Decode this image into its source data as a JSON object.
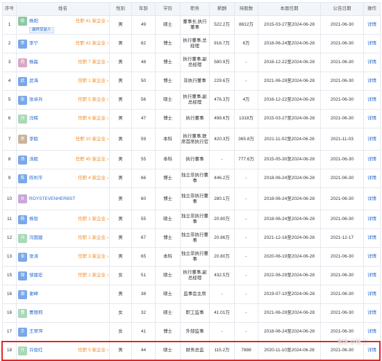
{
  "headers": [
    "序号",
    "姓名",
    "性别",
    "年龄",
    "学历",
    "职务",
    "薪酬",
    "持股数",
    "本届任期",
    "公告日期",
    "操作"
  ],
  "detail_label": "详情",
  "rows": [
    {
      "no": "1",
      "avatar": "杨",
      "avatar_color": "#8cc8a4",
      "name": "杨阳",
      "ent": "任职 41 家企业 ›",
      "tag": "最终受益人",
      "gender": "男",
      "age": "49",
      "edu": "硕士",
      "role": "董事长,执行董事",
      "pay": "522.2万",
      "shares": "8812万",
      "term": "2015-03-27至2024-06-28",
      "date": "2021-06-30"
    },
    {
      "no": "2",
      "avatar": "李",
      "avatar_color": "#7aa7e8",
      "name": "李宁",
      "ent": "任职 42 家企业 ›",
      "tag": "",
      "gender": "男",
      "age": "62",
      "edu": "博士",
      "role": "执行董事,总经理",
      "pay": "916.7万",
      "shares": "6万",
      "term": "2018-06-24至2024-06-28",
      "date": "2021-06-30"
    },
    {
      "no": "3",
      "avatar": "杨",
      "avatar_color": "#d8a8c4",
      "name": "杨磊",
      "ent": "任职 7 家企业 ›",
      "tag": "",
      "gender": "男",
      "age": "48",
      "edu": "博士",
      "role": "执行董事,副总经理",
      "pay": "580.9万",
      "shares": "-",
      "term": "2016-12-22至2024-06-28",
      "date": "2021-06-30"
    },
    {
      "no": "4",
      "avatar": "武",
      "avatar_color": "#7aa7e8",
      "name": "武海",
      "ent": "任职 1 家企业 ›",
      "tag": "",
      "gender": "男",
      "age": "50",
      "edu": "博士",
      "role": "非执行董事",
      "pay": "229.6万",
      "shares": "-",
      "term": "2021-06-29至2024-06-28",
      "date": "2021-06-30"
    },
    {
      "no": "5",
      "avatar": "张",
      "avatar_color": "#7aa7e8",
      "name": "张卓兵",
      "ent": "任职 5 家企业 ›",
      "tag": "",
      "gender": "男",
      "age": "56",
      "edu": "硕士",
      "role": "执行董事,副总经理",
      "pay": "476.3万",
      "shares": "4万",
      "term": "2016-12-22至2024-06-28",
      "date": "2021-06-30"
    },
    {
      "no": "6",
      "avatar": "冯",
      "avatar_color": "#a8d8b8",
      "name": "冯辉",
      "ent": "任职 6 家企业 ›",
      "tag": "",
      "gender": "男",
      "age": "47",
      "edu": "博士",
      "role": "执行董事",
      "pay": "498.6万",
      "shares": "1318万",
      "term": "2015-03-27至2024-06-28",
      "date": "2021-06-30"
    },
    {
      "no": "7",
      "avatar": "李",
      "avatar_color": "#c8b49c",
      "name": "李毅",
      "ent": "任职 10 家企业 ›",
      "tag": "",
      "gender": "男",
      "age": "59",
      "edu": "本科",
      "role": "执行董事,联席首席执行官",
      "pay": "420.3万",
      "shares": "365.8万",
      "term": "2021-11-02至2024-06-28",
      "date": "2021-11-03",
      "tall": true
    },
    {
      "no": "8",
      "avatar": "汤",
      "avatar_color": "#7aa7e8",
      "name": "汤毅",
      "ent": "任职 45 家企业 ›",
      "tag": "",
      "gender": "男",
      "age": "55",
      "edu": "本科",
      "role": "执行董事",
      "pay": "-",
      "shares": "777.6万",
      "term": "2015-05-30至2024-06-28",
      "date": "2021-06-30"
    },
    {
      "no": "9",
      "avatar": "陈",
      "avatar_color": "#7aa7e8",
      "name": "陈利平",
      "ent": "任职 4 家企业 ›",
      "tag": "",
      "gender": "男",
      "age": "66",
      "edu": "博士",
      "role": "独立非执行董事",
      "pay": "446.2万",
      "shares": "-",
      "term": "2018-06-24至2024-06-28",
      "date": "2021-06-30"
    },
    {
      "no": "10",
      "avatar": "R",
      "avatar_color": "#c8a8d8",
      "name": "ROYSTEVENHERBST",
      "ent": "",
      "tag": "",
      "gender": "男",
      "age": "60",
      "edu": "博士",
      "role": "独立非执行董事",
      "pay": "280.1万",
      "shares": "-",
      "term": "2018-06-24至2024-06-28",
      "date": "2021-06-30",
      "tall": true
    },
    {
      "no": "11",
      "avatar": "杨",
      "avatar_color": "#7aa7e8",
      "name": "杨智",
      "ent": "任职 1 家企业 ›",
      "tag": "",
      "gender": "男",
      "age": "55",
      "edu": "硕士",
      "role": "独立非执行董事",
      "pay": "20.80万",
      "shares": "-",
      "term": "2018-06-24至2024-06-28",
      "date": "2021-06-30"
    },
    {
      "no": "12",
      "avatar": "冯",
      "avatar_color": "#a8d8b8",
      "name": "冯国建",
      "ent": "任职 1 家企业 ›",
      "tag": "",
      "gender": "男",
      "age": "67",
      "edu": "博士",
      "role": "独立非执行董事",
      "pay": "20.86万",
      "shares": "-",
      "term": "2021-12-16至2024-06-28",
      "date": "2021-12-17"
    },
    {
      "no": "13",
      "avatar": "张",
      "avatar_color": "#7aa7e8",
      "name": "张涛",
      "ent": "任职 3 家企业 ›",
      "tag": "",
      "gender": "男",
      "age": "65",
      "edu": "本科",
      "role": "独立非执行董事",
      "pay": "20.80万",
      "shares": "-",
      "term": "2020-06-19至2024-06-28",
      "date": "2021-06-30"
    },
    {
      "no": "15",
      "avatar": "邹",
      "avatar_color": "#7aa7e8",
      "name": "邹建宏",
      "ent": "任职 1 家企业 ›",
      "tag": "",
      "gender": "女",
      "age": "51",
      "edu": "硕士",
      "role": "执行董事,副总经理",
      "pay": "432.5万",
      "shares": "-",
      "term": "2022-06-29至2024-06-28",
      "date": "2021-06-30"
    },
    {
      "no": "16",
      "avatar": "谢",
      "avatar_color": "#7aa7e8",
      "name": "谢峰",
      "ent": "",
      "tag": "",
      "gender": "男",
      "age": "38",
      "edu": "硕士",
      "role": "监事会主席",
      "pay": "-",
      "shares": "-",
      "term": "2019-07-10至2024-06-28",
      "date": "2021-06-30"
    },
    {
      "no": "16",
      "avatar": "曹",
      "avatar_color": "#a8d8b8",
      "name": "曹丽莉",
      "ent": "",
      "tag": "",
      "gender": "女",
      "age": "32",
      "edu": "硕士",
      "role": "职工监事",
      "pay": "41.01万",
      "shares": "-",
      "term": "2021-06-29至2024-06-28",
      "date": "2021-06-30"
    },
    {
      "no": "17",
      "avatar": "王",
      "avatar_color": "#7aa7e8",
      "name": "王翠萍",
      "ent": "",
      "tag": "",
      "gender": "女",
      "age": "41",
      "edu": "博士",
      "role": "外部监事",
      "pay": "-",
      "shares": "-",
      "term": "2018-06-24至2024-06-28",
      "date": "2021-06-30"
    },
    {
      "no": "18",
      "avatar": "许",
      "avatar_color": "#a8d8b8",
      "name": "许俊红",
      "ent": "任职 5 家企业 ›",
      "tag": "",
      "gender": "男",
      "age": "44",
      "edu": "硕士",
      "role": "财务总监",
      "pay": "115.2万",
      "shares": "7888",
      "term": "2020-11-10至2024-06-28",
      "date": "2021-06-30",
      "highlight": true
    }
  ],
  "watermark": "雪球 @杨 二"
}
